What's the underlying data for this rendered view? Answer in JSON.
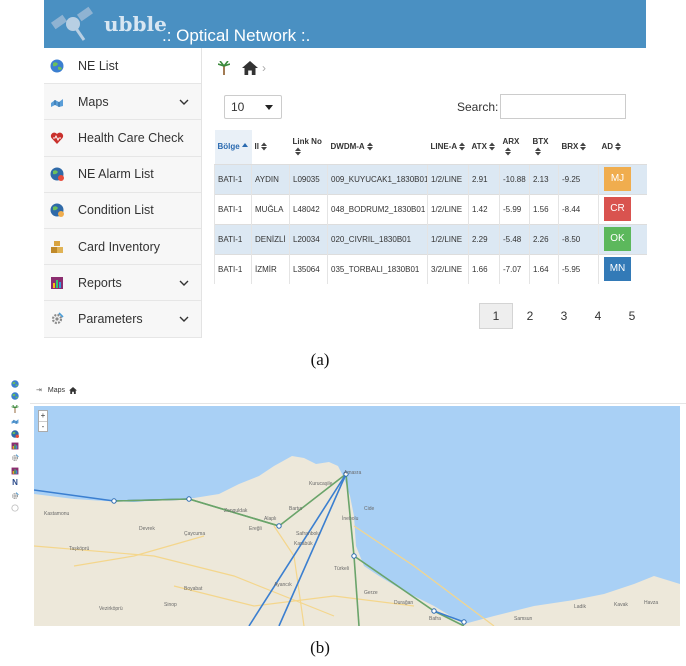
{
  "panel_a": {
    "logo_text": "ubble",
    "app_title": ".: Optical Network :.",
    "sidebar": [
      {
        "label": "NE List",
        "icon": "globe-icon",
        "has_chevron": false
      },
      {
        "label": "Maps",
        "icon": "map-icon",
        "has_chevron": true
      },
      {
        "label": "Health Care Check",
        "icon": "heart-icon",
        "has_chevron": false
      },
      {
        "label": "NE Alarm List",
        "icon": "globe-alarm-icon",
        "has_chevron": false
      },
      {
        "label": "Condition List",
        "icon": "globe-condition-icon",
        "has_chevron": false
      },
      {
        "label": "Card Inventory",
        "icon": "boxes-icon",
        "has_chevron": false
      },
      {
        "label": "Reports",
        "icon": "report-icon",
        "has_chevron": true
      },
      {
        "label": "Parameters",
        "icon": "gear-icon",
        "has_chevron": true
      }
    ],
    "page_length": "10",
    "search_label": "Search:",
    "search_value": "",
    "columns": [
      "Bölge",
      "Il",
      "Link No",
      "DWDM-A",
      "LINE-A",
      "ATX",
      "ARX",
      "BTX",
      "BRX",
      "AD"
    ],
    "rows": [
      {
        "bolge": "BATI-1",
        "il": "AYDIN",
        "link": "L09035",
        "dwdm": "009_KUYUCAK1_1830B01",
        "line": "1/2/LINE",
        "atx": "2.91",
        "arx": "-10.88",
        "btx": "2.13",
        "brx": "-9.25",
        "ad": "MJ",
        "ad_color": "#f0ad4e"
      },
      {
        "bolge": "BATI-1",
        "il": "MUĞLA",
        "link": "L48042",
        "dwdm": "048_BODRUM2_1830B01",
        "line": "1/2/LINE",
        "atx": "1.42",
        "arx": "-5.99",
        "btx": "1.56",
        "brx": "-8.44",
        "ad": "CR",
        "ad_color": "#d9534f"
      },
      {
        "bolge": "BATI-1",
        "il": "DENİZLİ",
        "link": "L20034",
        "dwdm": "020_CIVRIL_1830B01",
        "line": "1/2/LINE",
        "atx": "2.29",
        "arx": "-5.48",
        "btx": "2.26",
        "brx": "-8.50",
        "ad": "OK",
        "ad_color": "#5cb85c"
      },
      {
        "bolge": "BATI-1",
        "il": "İZMİR",
        "link": "L35064",
        "dwdm": "035_TORBALI_1830B01",
        "line": "3/2/LINE",
        "atx": "1.66",
        "arx": "-7.07",
        "btx": "1.64",
        "brx": "-5.95",
        "ad": "MN",
        "ad_color": "#337ab7"
      }
    ],
    "pages": [
      "1",
      "2",
      "3",
      "4",
      "5"
    ],
    "current_page": "1",
    "caption": "(a)"
  },
  "panel_b": {
    "breadcrumb": "Maps",
    "zoom_in": "+",
    "zoom_out": "-",
    "places": [
      "Amasra",
      "Kurucaşile",
      "Cide",
      "İnebolu",
      "Bartın",
      "Zonguldak",
      "Ereğli",
      "Alaplı",
      "Karabük",
      "Safranbolu",
      "Devrek",
      "Çaycuma",
      "Kastamonu",
      "Taşköprü",
      "Boyabat",
      "Sinop",
      "Ayancık",
      "Türkeli",
      "Gerze",
      "Durağan",
      "Bafra",
      "Samsun",
      "Ladik",
      "Kavak",
      "Havza",
      "Vezirköprü"
    ],
    "caption": "(b)",
    "colors": {
      "sea": "#a9d0f5",
      "land": "#ede8da",
      "link_green": "#6aa46a",
      "link_blue": "#3b7fd0"
    }
  }
}
